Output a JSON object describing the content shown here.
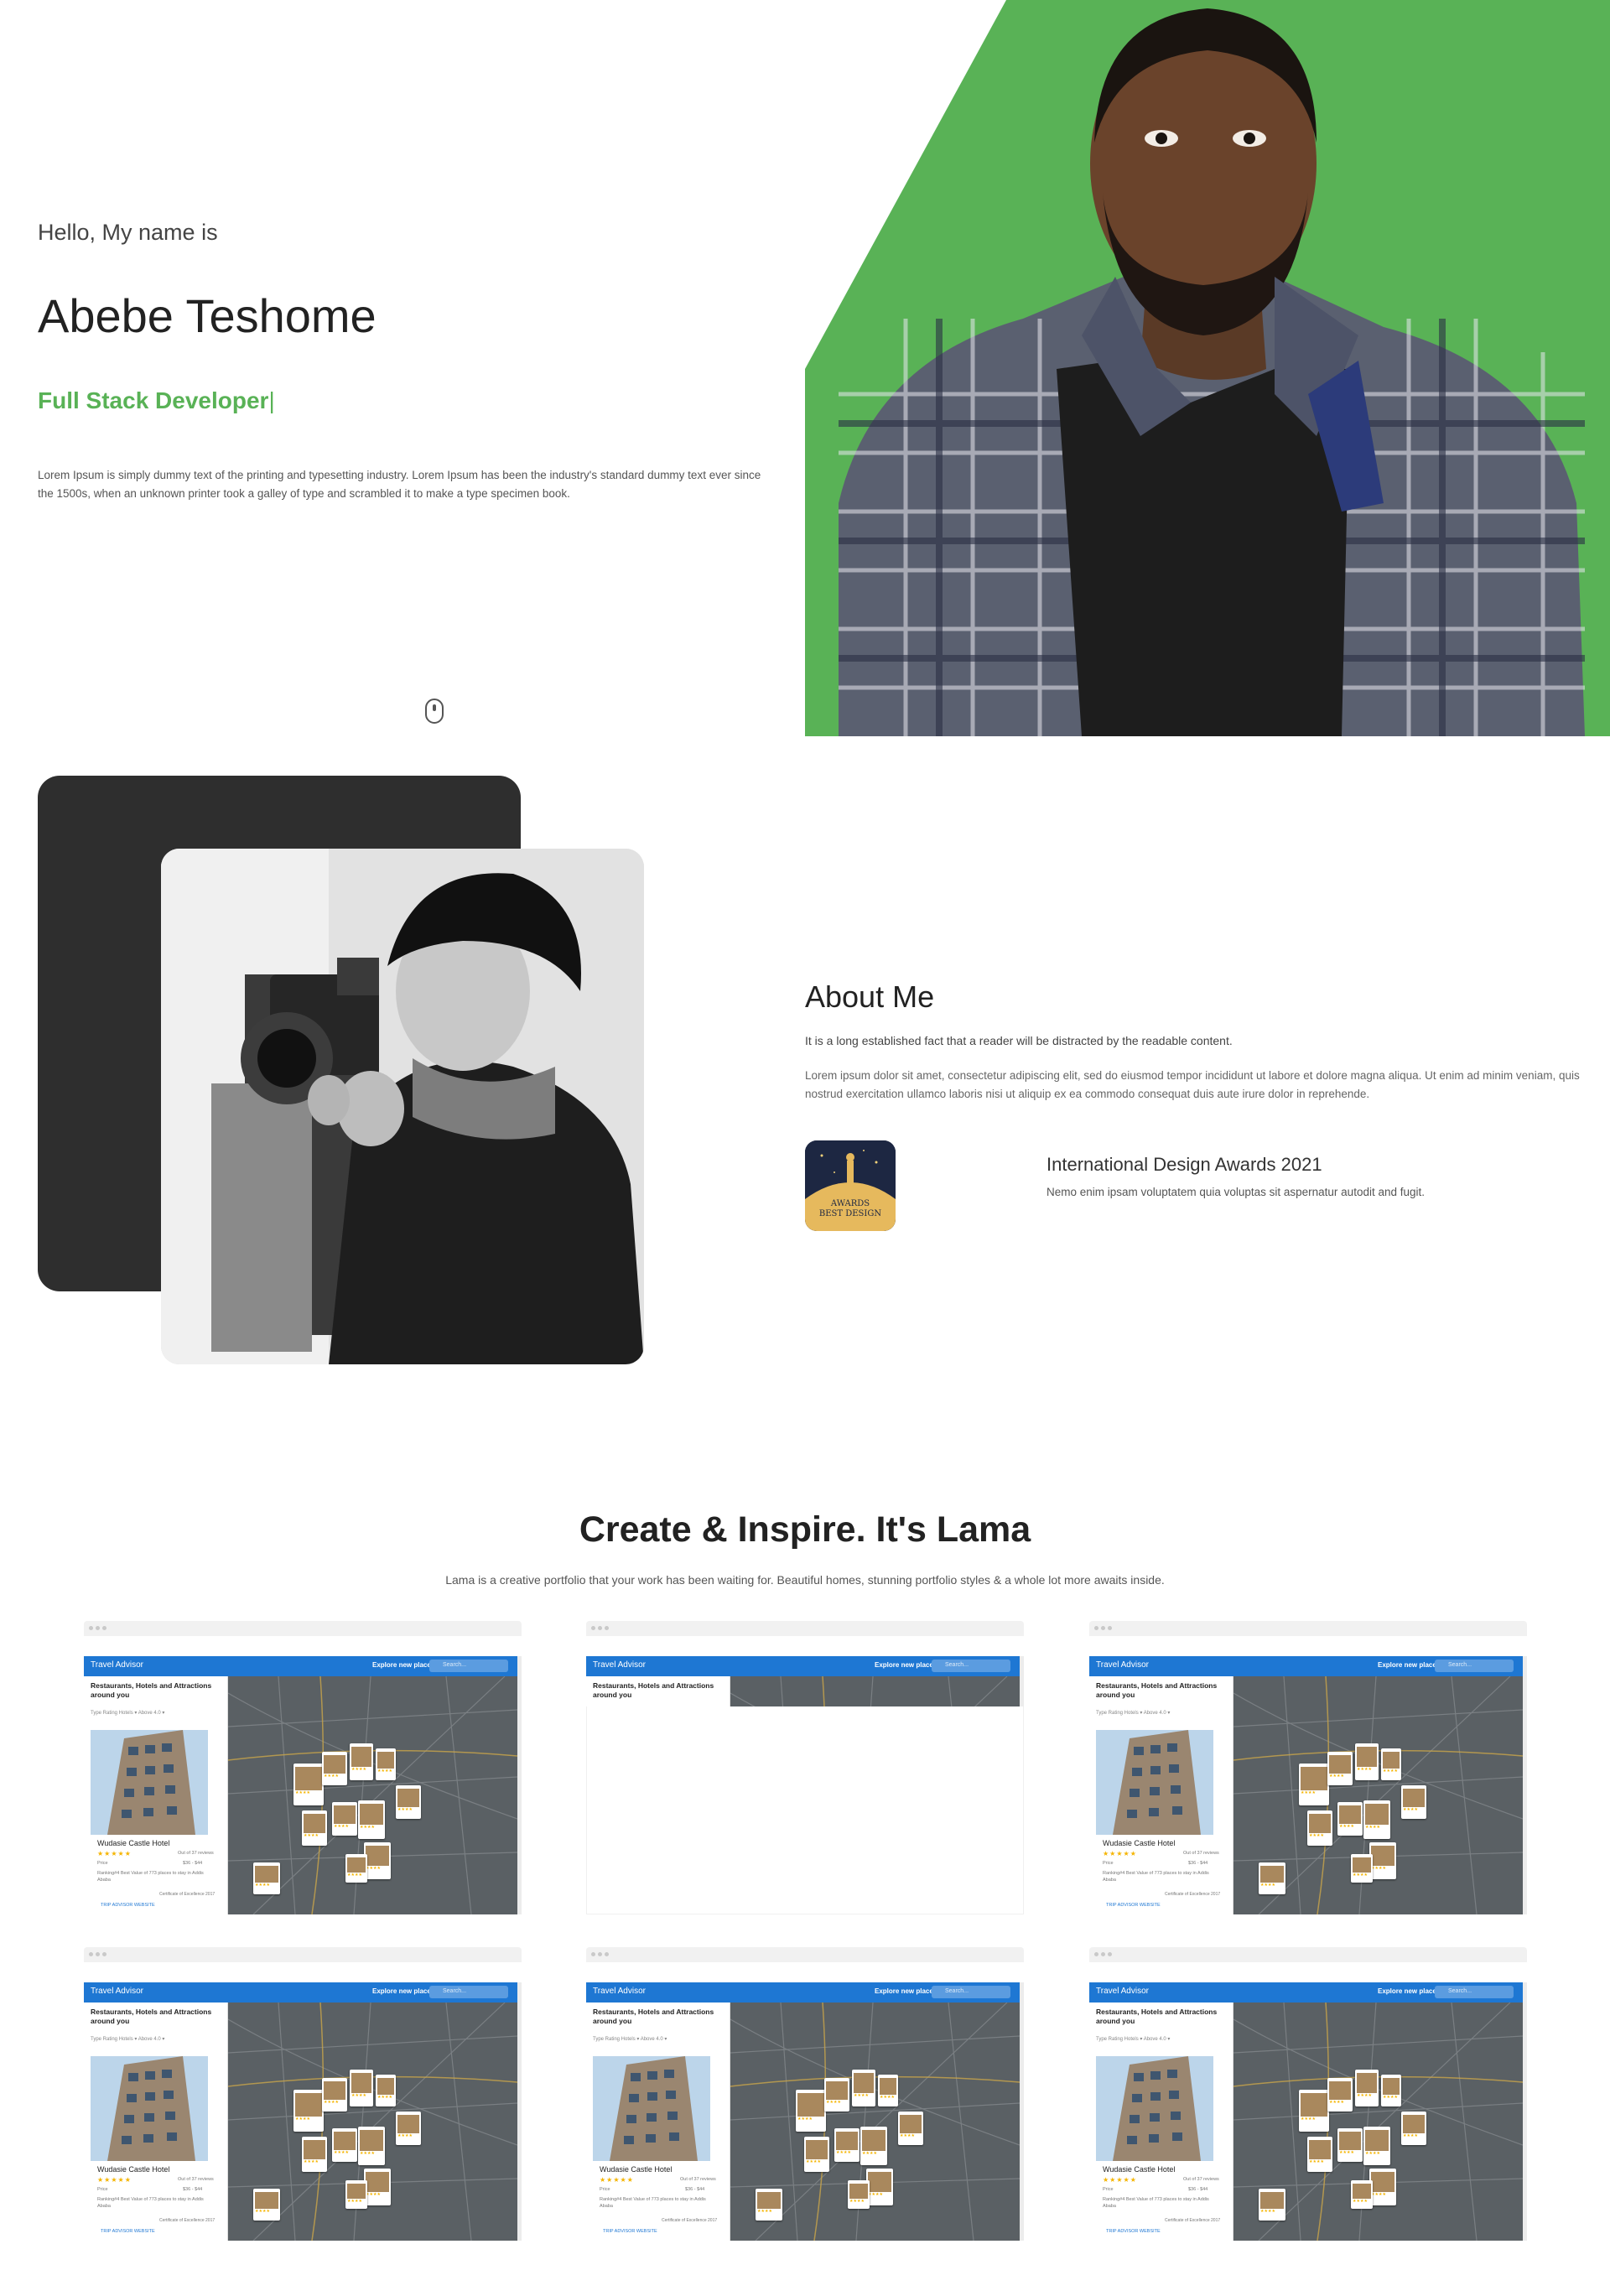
{
  "hero": {
    "greeting": "Hello, My name is",
    "name": "Abebe Teshome",
    "role": "Full Stack Developer",
    "role_cursor": "|",
    "description": "Lorem Ipsum is simply dummy text of the printing and typesetting industry. Lorem Ipsum has been the industry's standard dummy text ever since the 1500s, when an unknown printer took a galley of type and scrambled it to make a type specimen book.",
    "accent_color": "#59b256",
    "scroll_icon": "mouse-scroll-icon"
  },
  "about": {
    "title": "About Me",
    "lead": "It is a long established fact that a reader will be distracted by the readable content.",
    "body": "Lorem ipsum dolor sit amet, consectetur adipiscing elit, sed do eiusmod tempor incididunt ut labore et dolore magna aliqua. Ut enim ad minim veniam, quis nostrud exercitation ullamco laboris nisi ut aliquip ex ea commodo consequat duis aute irure dolor in reprehende.",
    "award": {
      "badge_line1": "AWARDS",
      "badge_line2": "BEST DESIGN",
      "title": "International Design Awards 2021",
      "description": "Nemo enim ipsam voluptatem quia voluptas sit aspernatur autodit and fugit."
    }
  },
  "portfolio": {
    "title": "Create & Inspire. It's Lama",
    "description": "Lama is a creative portfolio that your work has been waiting for. Beautiful homes, stunning portfolio styles & a whole lot more awaits inside.",
    "project": {
      "brand": "Travel Advisor",
      "explore": "Explore new places",
      "search_placeholder": "Search...",
      "heading": "Restaurants, Hotels and Attractions around you",
      "filters": "Type        Rating     Hotels  ▾   Above 4.0  ▾",
      "hotel_name": "Wudasie Castle Hotel",
      "stars": "★★★★★",
      "reviews": "Out of 37 reviews",
      "price_label": "Price",
      "price_value": "$36 - $44",
      "ranking": "Ranking#4 Best Value of 773 places to stay in Addis Ababa",
      "certificate": "Certificate of Excellence 2017",
      "links": "TRIP ADVISOR     WEBSITE"
    }
  }
}
